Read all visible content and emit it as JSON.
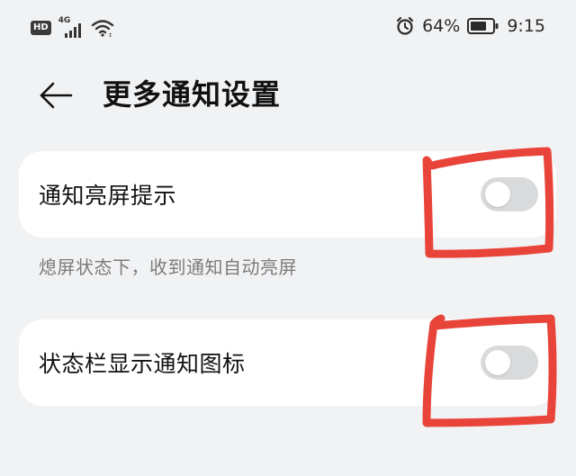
{
  "status_bar": {
    "hd_badge": "HD",
    "network_label": "4G",
    "battery_percent": "64%",
    "time": "9:15",
    "icons": [
      "signal-icon",
      "wifi-icon",
      "alarm-icon",
      "battery-icon"
    ]
  },
  "header": {
    "title": "更多通知设置",
    "back_icon": "arrow-left-icon"
  },
  "settings": [
    {
      "label": "通知亮屏提示",
      "description": "熄屏状态下，收到通知自动亮屏",
      "enabled": false
    },
    {
      "label": "状态栏显示通知图标",
      "description": "",
      "enabled": false
    }
  ],
  "colors": {
    "background": "#f1f2f4",
    "card": "#ffffff",
    "toggle_off": "#d9dadb",
    "annotation_red": "#e8443a",
    "description_text": "#7b7b7b"
  }
}
